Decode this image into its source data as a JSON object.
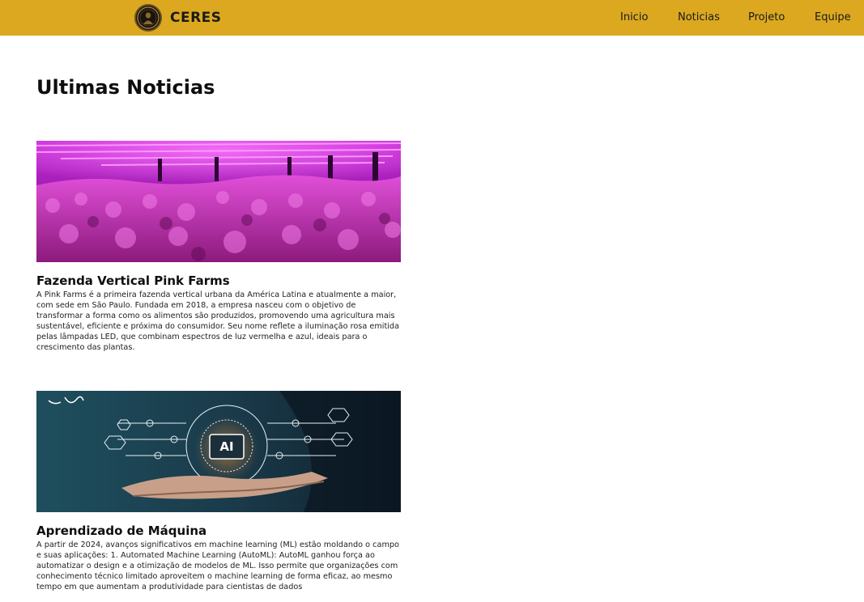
{
  "header": {
    "brand": "CERES",
    "logo_icon": "ceres-seal-logo-icon",
    "nav": [
      {
        "label": "Inicio"
      },
      {
        "label": "Noticias"
      },
      {
        "label": "Projeto"
      },
      {
        "label": "Equipe"
      }
    ],
    "bar_color": "#dba820"
  },
  "main": {
    "title": "Ultimas Noticias",
    "articles": [
      {
        "title": "Fazenda Vertical Pink Farms",
        "text": "A Pink Farms é a primeira fazenda vertical urbana da América Latina e atualmente a maior, com sede em São Paulo. Fundada em 2018, a empresa nasceu com o objetivo de transformar a forma como os alimentos são produzidos, promovendo uma agricultura mais sustentável, eficiente e próxima do consumidor. Seu nome reflete a iluminação rosa emitida pelas lâmpadas LED, que combinam espectros de luz vermelha e azul, ideais para o crescimento das plantas.",
        "image": "pink-led-vertical-farm-photo"
      },
      {
        "title": "Aprendizado de Máquina",
        "text": "A partir de 2024, avanços significativos em machine learning (ML) estão moldando o campo e suas aplicações: 1. Automated Machine Learning (AutoML): AutoML ganhou força ao automatizar o design e a otimização de modelos de ML. Isso permite que organizações com conhecimento técnico limitado aproveitem o machine learning de forma eficaz, ao mesmo tempo em que aumentam a produtividade para cientistas de dados",
        "image": "ai-chip-hand-illustration",
        "image_label": "AI"
      }
    ]
  }
}
